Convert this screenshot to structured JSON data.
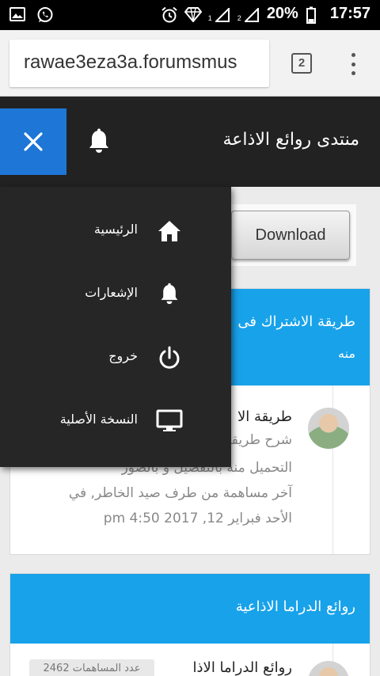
{
  "status_bar": {
    "sim1": "1",
    "sim2": "2",
    "battery": "20%",
    "time": "17:57"
  },
  "browser": {
    "url": "rawae3eza3a.forumsmus",
    "tab_count": "2"
  },
  "header": {
    "title": "منتدى روائع الاذاعة"
  },
  "ad": {
    "download_label": "Download"
  },
  "drawer": {
    "items": [
      {
        "label": "الرئيسية",
        "icon": "home-icon"
      },
      {
        "label": "الإشعارات",
        "icon": "bell-icon"
      },
      {
        "label": "خروج",
        "icon": "power-icon"
      },
      {
        "label": "النسخة الأصلية",
        "icon": "monitor-icon"
      }
    ]
  },
  "cards": [
    {
      "header_line1": "طريقة الاشتراك فى",
      "header_line2": "منه",
      "topic_title": "طريقة الا",
      "topic_snippet": "شرح طريقة",
      "description": "التحميل منه بالتفصيل و بالصور",
      "last_post": "آخر مساهمة من طرف صيد الخاطر, في",
      "last_post_date": "الأحد فبراير 12, 2017 4:50 pm"
    },
    {
      "header": "روائع الدراما الاذاعية",
      "topic_title": "روائع الدراما الاذا",
      "posts_badge": "عدد المساهمات 2462"
    }
  ]
}
